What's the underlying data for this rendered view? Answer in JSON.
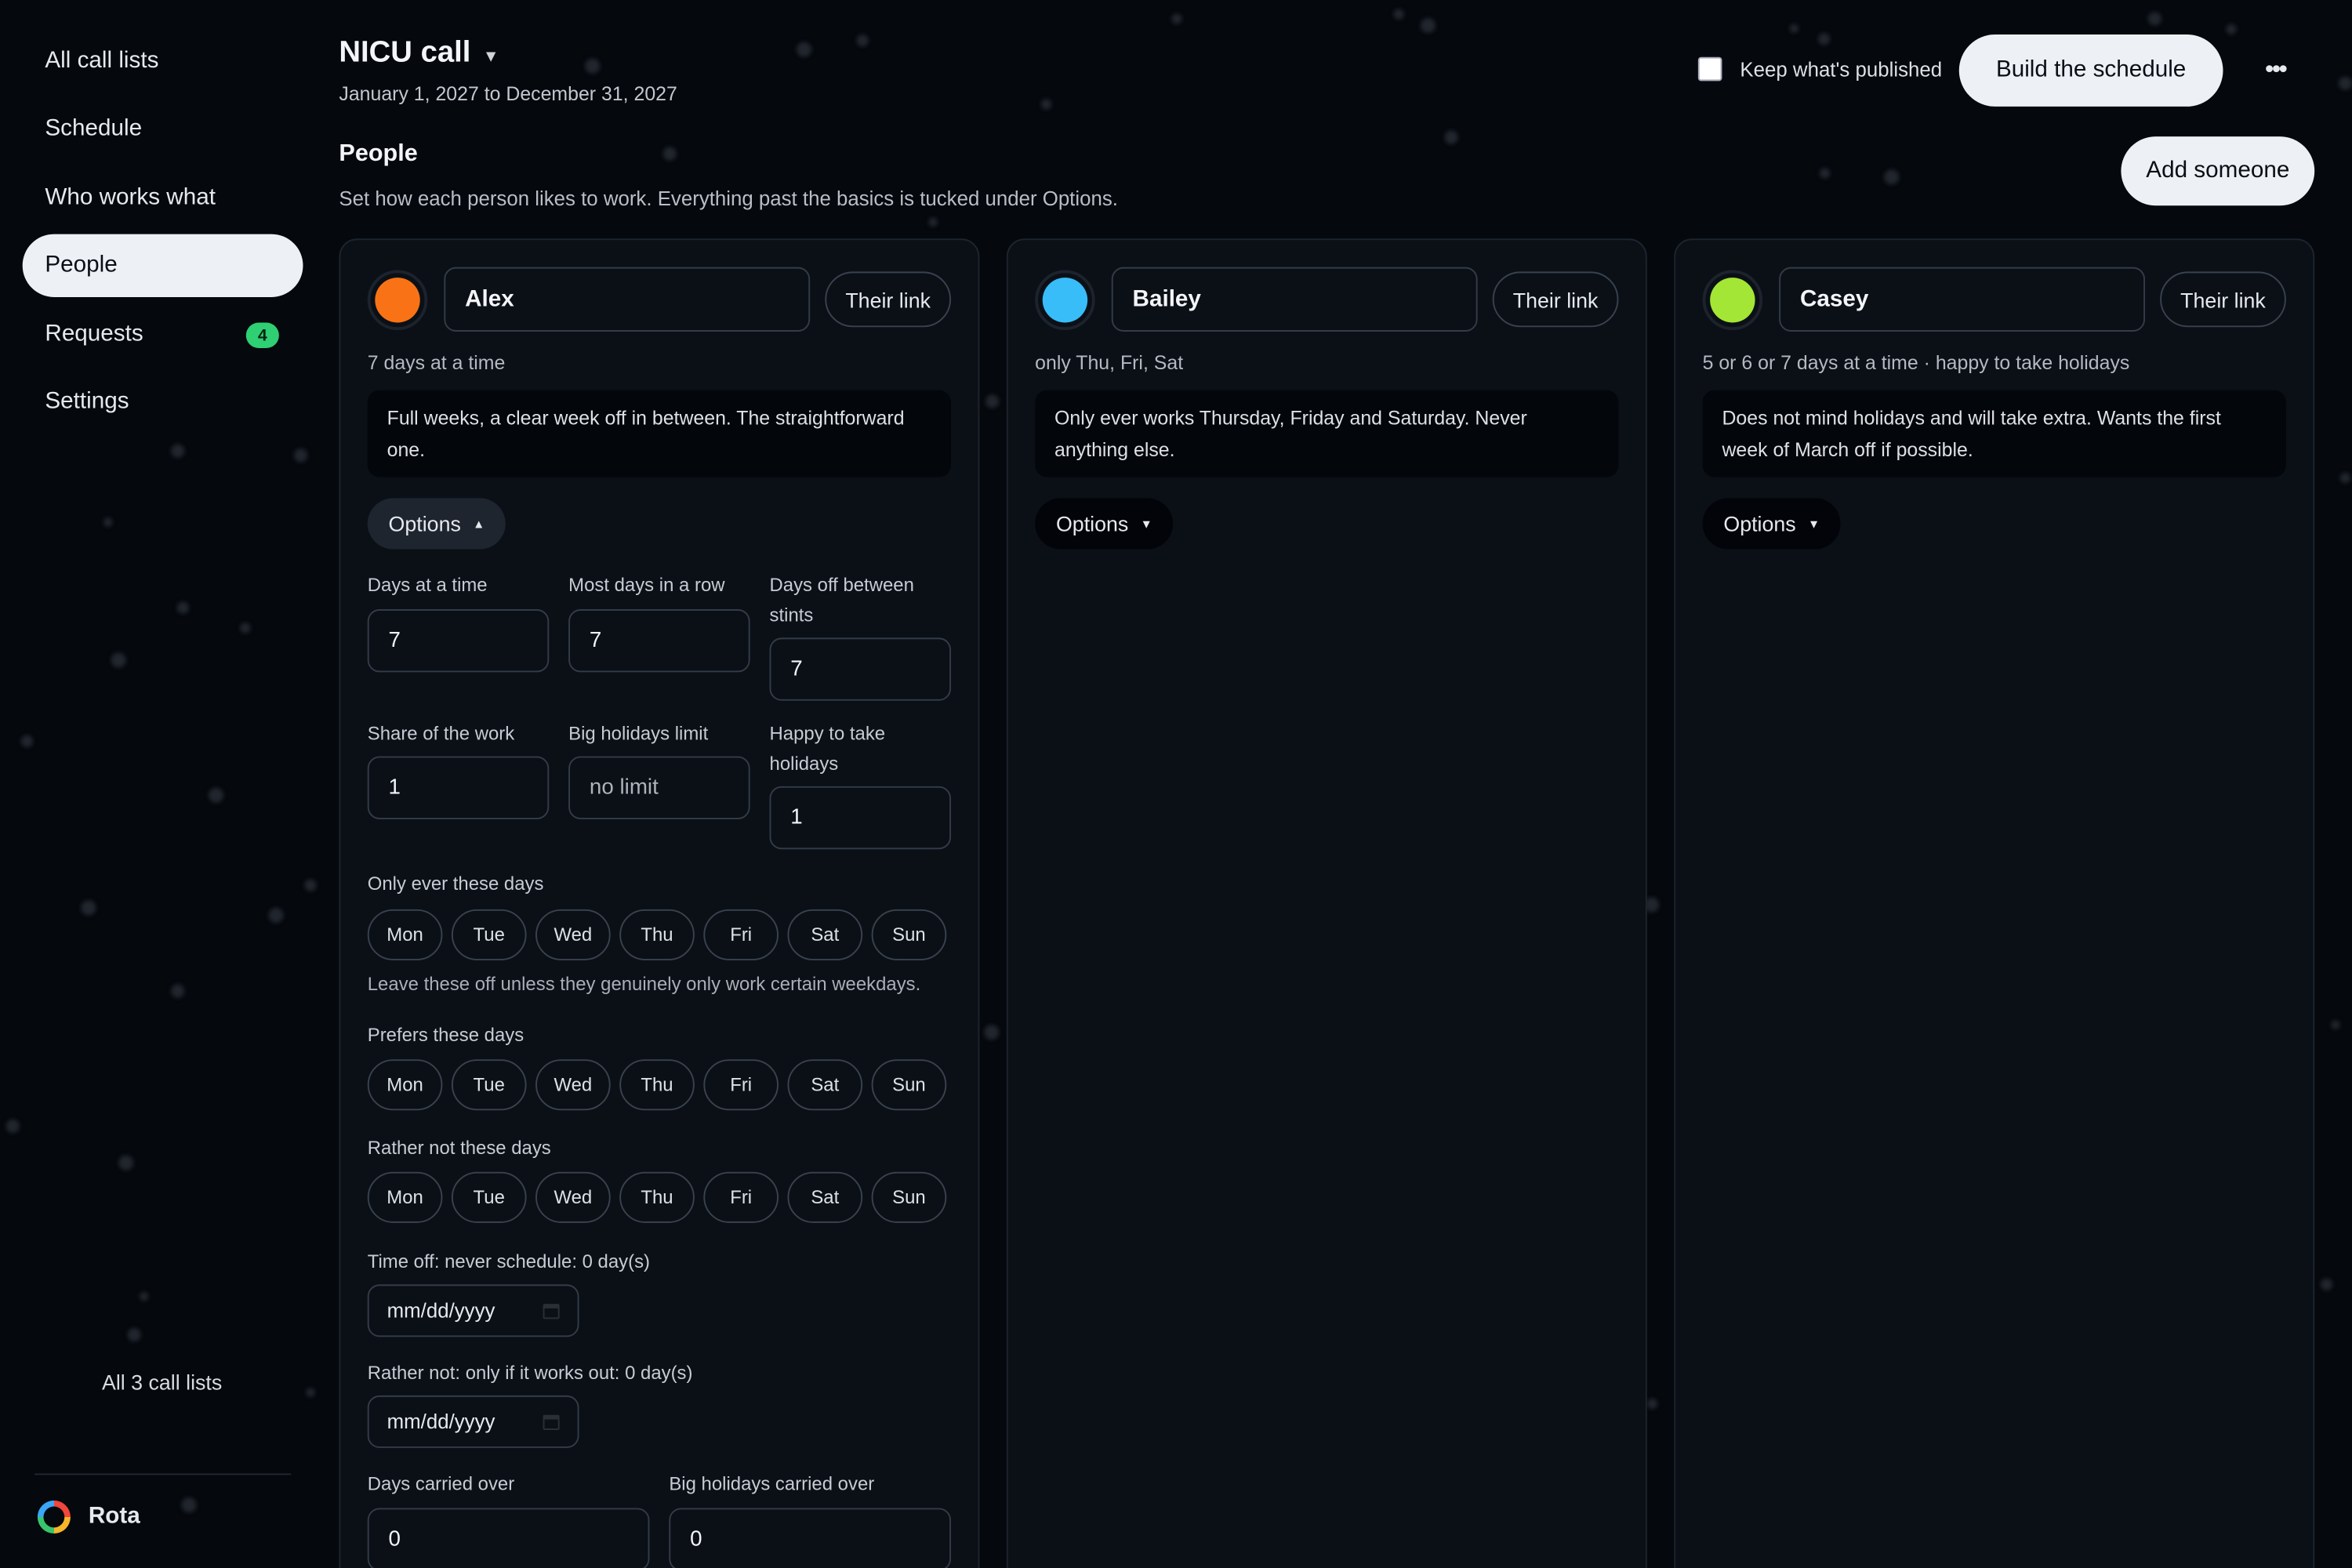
{
  "sidebar": {
    "items": [
      {
        "label": "All call lists"
      },
      {
        "label": "Schedule"
      },
      {
        "label": "Who works what"
      },
      {
        "label": "People"
      },
      {
        "label": "Requests",
        "badge": "4"
      },
      {
        "label": "Settings"
      }
    ],
    "footer_link": "All 3 call lists",
    "brand": "Rota"
  },
  "header": {
    "title": "NICU call",
    "date_range": "January 1, 2027 to December 31, 2027",
    "keep_published": "Keep what's published",
    "build_button": "Build the schedule",
    "more_icon": "•••"
  },
  "section": {
    "title": "People",
    "subtitle": "Set how each person likes to work. Everything past the basics is tucked under Options.",
    "add_button": "Add someone"
  },
  "people": [
    {
      "name": "Alex",
      "color": "#f97316",
      "link_label": "Their link",
      "summary": "7 days at a time",
      "note": "Full weeks, a clear week off in between. The straightforward one.",
      "options_label": "Options",
      "options_caret": "▲",
      "fields": {
        "days_at_a_time": {
          "label": "Days at a time",
          "value": "7"
        },
        "most_days_in_row": {
          "label": "Most days in a row",
          "value": "7"
        },
        "days_off_between": {
          "label": "Days off between stints",
          "value": "7"
        },
        "share_of_work": {
          "label": "Share of the work",
          "value": "1"
        },
        "big_holidays_limit": {
          "label": "Big holidays limit",
          "placeholder": "no limit"
        },
        "happy_holidays": {
          "label": "Happy to take holidays",
          "value": "1"
        }
      },
      "only_days": {
        "label": "Only ever these days",
        "help": "Leave these off unless they genuinely only work certain weekdays."
      },
      "prefers_days": {
        "label": "Prefers these days"
      },
      "rather_not_days": {
        "label": "Rather not these days"
      },
      "weekdays": [
        "Mon",
        "Tue",
        "Wed",
        "Thu",
        "Fri",
        "Sat",
        "Sun"
      ],
      "time_off": {
        "label": "Time off: never schedule: 0 day(s)",
        "placeholder": "mm/dd/yyyy"
      },
      "rather_not": {
        "label": "Rather not: only if it works out: 0 day(s)",
        "placeholder": "mm/dd/yyyy"
      },
      "carried_over": {
        "label": "Days carried over",
        "value": "0"
      },
      "holidays_carried": {
        "label": "Big holidays carried over",
        "value": "0"
      }
    },
    {
      "name": "Bailey",
      "color": "#38bdf8",
      "link_label": "Their link",
      "summary": "only Thu, Fri, Sat",
      "note": "Only ever works Thursday, Friday and Saturday. Never anything else.",
      "options_label": "Options",
      "options_caret": "▼"
    },
    {
      "name": "Casey",
      "color": "#a3e635",
      "link_label": "Their link",
      "summary": "5 or 6 or 7 days at a time · happy to take holidays",
      "note": "Does not mind holidays and will take extra. Wants the first week of March off if possible.",
      "options_label": "Options",
      "options_caret": "▼"
    }
  ]
}
